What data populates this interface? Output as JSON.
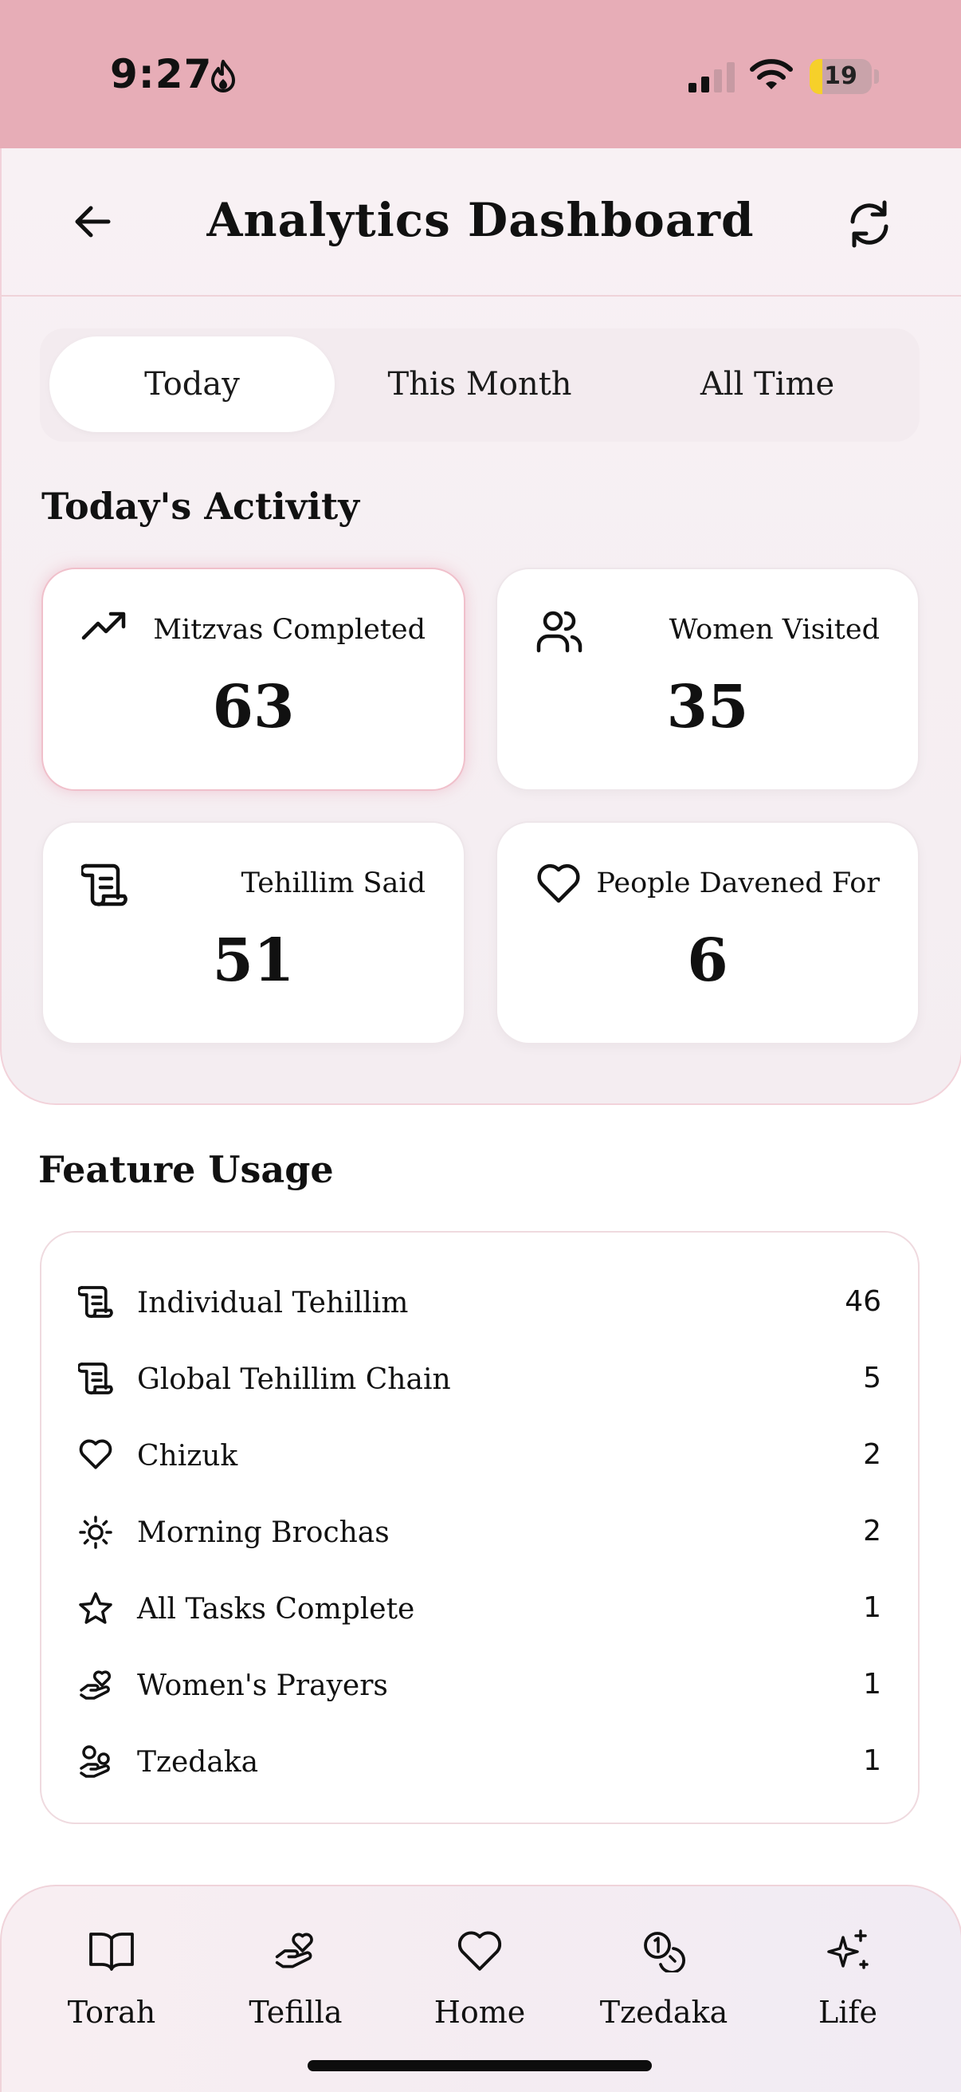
{
  "status_bar": {
    "time": "9:27",
    "battery": "19",
    "icons": [
      "flame-icon",
      "signal-icon",
      "wifi-icon",
      "battery-icon"
    ]
  },
  "header": {
    "title": "Analytics Dashboard",
    "back_icon": "arrow-left-icon",
    "refresh_icon": "refresh-icon"
  },
  "tabs": [
    {
      "label": "Today",
      "active": true
    },
    {
      "label": "This Month",
      "active": false
    },
    {
      "label": "All Time",
      "active": false
    }
  ],
  "activity": {
    "title": "Today's Activity",
    "cards": [
      {
        "label": "Mitzvas Completed",
        "value": "63",
        "icon": "trending-up-icon",
        "highlighted": true
      },
      {
        "label": "Women Visited",
        "value": "35",
        "icon": "users-icon"
      },
      {
        "label": "Tehillim Said",
        "value": "51",
        "icon": "scroll-icon"
      },
      {
        "label": "People Davened For",
        "value": "6",
        "icon": "heart-icon"
      }
    ]
  },
  "feature_usage": {
    "title": "Feature Usage",
    "items": [
      {
        "label": "Individual Tehillim",
        "value": "46",
        "icon": "scroll-icon"
      },
      {
        "label": "Global Tehillim Chain",
        "value": "5",
        "icon": "scroll-icon"
      },
      {
        "label": "Chizuk",
        "value": "2",
        "icon": "heart-icon"
      },
      {
        "label": "Morning Brochas",
        "value": "2",
        "icon": "sun-icon"
      },
      {
        "label": "All Tasks Complete",
        "value": "1",
        "icon": "star-icon"
      },
      {
        "label": "Women's Prayers",
        "value": "1",
        "icon": "hand-heart-icon"
      },
      {
        "label": "Tzedaka",
        "value": "1",
        "icon": "hand-coins-icon"
      }
    ]
  },
  "bottom_nav": [
    {
      "label": "Torah",
      "icon": "book-open-icon"
    },
    {
      "label": "Tefilla",
      "icon": "hand-heart-icon"
    },
    {
      "label": "Home",
      "icon": "heart-icon"
    },
    {
      "label": "Tzedaka",
      "icon": "coins-icon"
    },
    {
      "label": "Life",
      "icon": "sparkles-icon"
    }
  ],
  "colors": {
    "status_bar_bg": "#e7adb7",
    "panel_bg": "#f6eff3",
    "card_highlight_border": "#f0c0cb"
  }
}
